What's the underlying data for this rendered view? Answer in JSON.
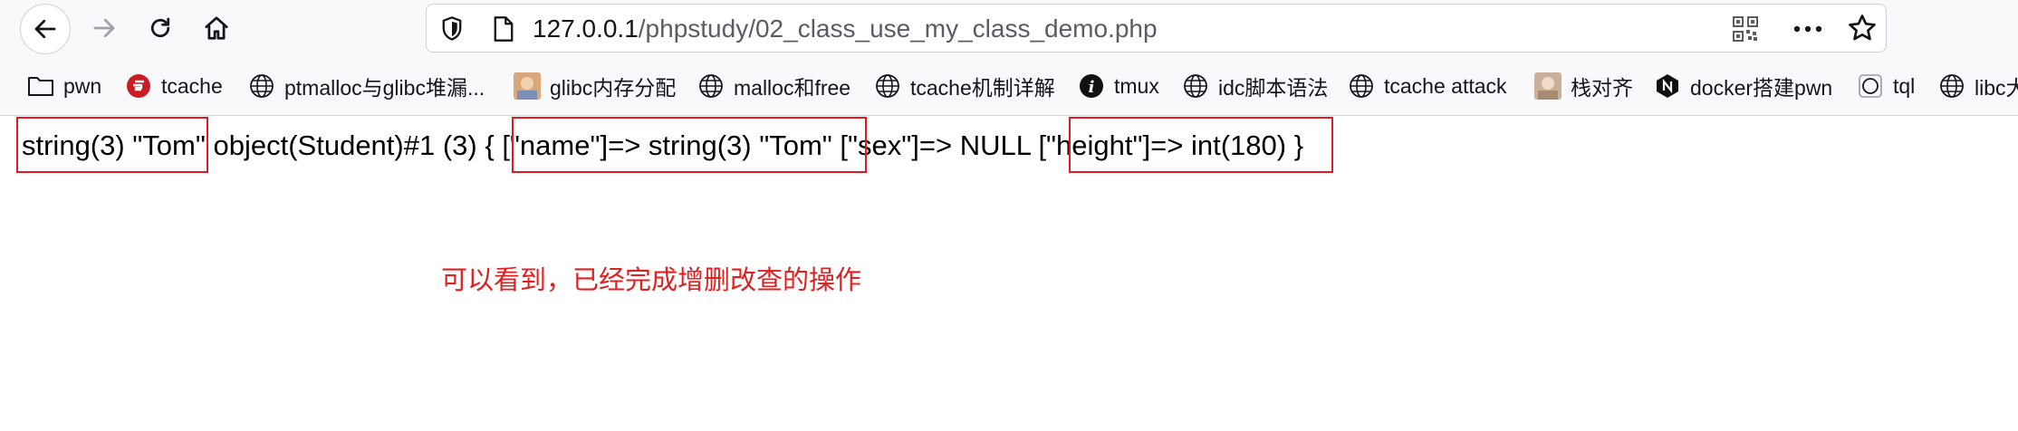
{
  "browser": {
    "url_host": "127.0.0.1",
    "url_path": "/phpstudy/02_class_use_my_class_demo.php"
  },
  "bookmarks": [
    {
      "label": "pwn",
      "icon": "folder-icon"
    },
    {
      "label": "tcache",
      "icon": "gitee-logo-icon"
    },
    {
      "label": "ptmalloc与glibc堆漏...",
      "icon": "globe-icon"
    },
    {
      "label": "glibc内存分配",
      "icon": "avatar-image-icon"
    },
    {
      "label": "malloc和free",
      "icon": "globe-icon"
    },
    {
      "label": "tcache机制详解",
      "icon": "globe-icon"
    },
    {
      "label": "tmux",
      "icon": "info-icon"
    },
    {
      "label": "idc脚本语法",
      "icon": "globe-icon"
    },
    {
      "label": "tcache attack",
      "icon": "globe-icon"
    },
    {
      "label": "栈对齐",
      "icon": "avatar-image-icon"
    },
    {
      "label": "docker搭建pwn",
      "icon": "hexagon-n-icon"
    },
    {
      "label": "tql",
      "icon": "circle-outline-icon"
    },
    {
      "label": "libc大",
      "icon": "globe-icon"
    }
  ],
  "output": {
    "seg1": "string(3) \"Tom\"",
    "seg2": " object(Student)#1 (3) { ",
    "seg3": "[\"name\"]=> string(3) \"Tom\"",
    "seg4": " [\"sex\"]=> NULL ",
    "seg5": "[\"height\"]=> int(180)",
    "seg6": " }"
  },
  "annotation": "可以看到，已经完成增删改查的操作",
  "colors": {
    "highlight_box": "#e01b24",
    "annotation_text": "#e02020"
  }
}
